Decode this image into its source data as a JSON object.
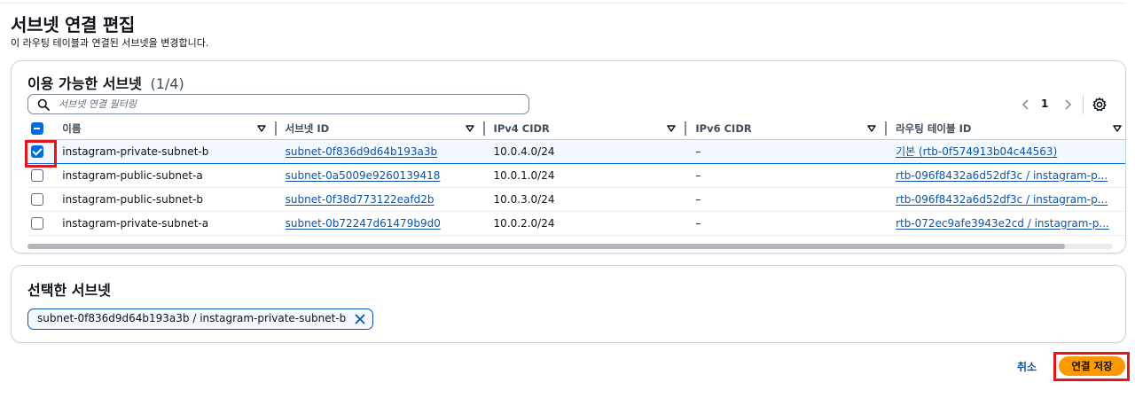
{
  "page": {
    "title": "서브넷 연결 편집",
    "description": "이 라우팅 테이블과 연결된 서브넷을 변경합니다."
  },
  "available": {
    "title": "이용 가능한 서브넷",
    "count": "(1/4)",
    "filter_placeholder": "서브넷 연결 필터링",
    "page_number": "1",
    "columns": [
      "이름",
      "서브넷 ID",
      "IPv4 CIDR",
      "IPv6 CIDR",
      "라우팅 테이블 ID"
    ],
    "rows": [
      {
        "checked": true,
        "name": "instagram-private-subnet-b",
        "subnet_id": "subnet-0f836d9d64b193a3b",
        "ipv4": "10.0.4.0/24",
        "ipv6": "–",
        "route_table": "기본 (rtb-0f574913b04c44563)"
      },
      {
        "checked": false,
        "name": "instagram-public-subnet-a",
        "subnet_id": "subnet-0a5009e9260139418",
        "ipv4": "10.0.1.0/24",
        "ipv6": "–",
        "route_table": "rtb-096f8432a6d52df3c / instagram-p..."
      },
      {
        "checked": false,
        "name": "instagram-public-subnet-b",
        "subnet_id": "subnet-0f38d773122eafd2b",
        "ipv4": "10.0.3.0/24",
        "ipv6": "–",
        "route_table": "rtb-096f8432a6d52df3c / instagram-p..."
      },
      {
        "checked": false,
        "name": "instagram-private-subnet-a",
        "subnet_id": "subnet-0b72247d61479b9d0",
        "ipv4": "10.0.2.0/24",
        "ipv6": "–",
        "route_table": "rtb-072ec9afe3943e2cd / instagram-p..."
      }
    ]
  },
  "selected": {
    "title": "선택한 서브넷",
    "token": "subnet-0f836d9d64b193a3b / instagram-private-subnet-b"
  },
  "actions": {
    "cancel_label": "취소",
    "save_label": "연결 저장"
  },
  "colors": {
    "primary_button": "#ff9900",
    "link": "#0e54a8",
    "selection": "#006ce0",
    "highlight_box": "#e3171b"
  },
  "icons": [
    "search-icon",
    "chevron-left-icon",
    "chevron-right-icon",
    "settings-gear-icon",
    "sort-caret-icon",
    "close-icon"
  ]
}
